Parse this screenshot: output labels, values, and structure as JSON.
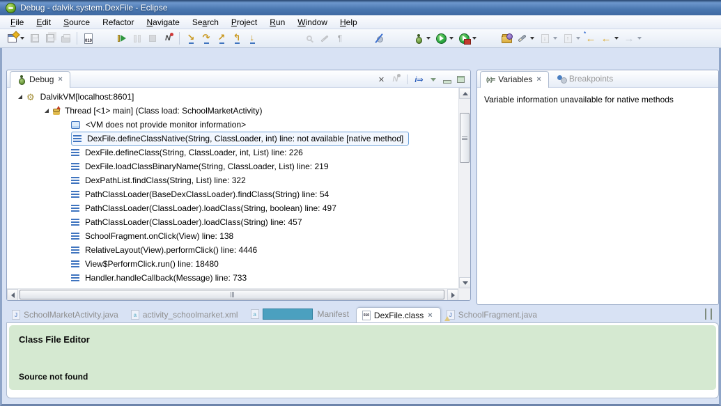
{
  "window": {
    "title": "Debug - dalvik.system.DexFile - Eclipse"
  },
  "menu": {
    "items": [
      {
        "pre": "",
        "key": "F",
        "post": "ile"
      },
      {
        "pre": "",
        "key": "E",
        "post": "dit"
      },
      {
        "pre": "",
        "key": "S",
        "post": "ource"
      },
      {
        "pre": "Refactor",
        "key": "",
        "post": ""
      },
      {
        "pre": "",
        "key": "N",
        "post": "avigate"
      },
      {
        "pre": "Se",
        "key": "a",
        "post": "rch"
      },
      {
        "pre": "",
        "key": "P",
        "post": "roject"
      },
      {
        "pre": "",
        "key": "R",
        "post": "un"
      },
      {
        "pre": "",
        "key": "W",
        "post": "indow"
      },
      {
        "pre": "",
        "key": "H",
        "post": "elp"
      }
    ]
  },
  "glyphs": {
    "gear": "⚙",
    "paragraph": "¶",
    "step_into": "↘",
    "step_over": "↷",
    "step_return": "↗",
    "drop_frame": "↰",
    "step_filters": "↓",
    "back": "←",
    "forward": "→",
    "last_edit": "←",
    "binary": "010",
    "disconnect_n": "N",
    "info": "i⇒",
    "remove_terminated": "✕",
    "close": "×",
    "annot_down": "↓",
    "annot_up": "↑"
  },
  "debug": {
    "tab_label": "Debug",
    "tree": [
      {
        "label": "DalvikVM[localhost:8601]"
      },
      {
        "label": "Thread [<1> main] (Class load: SchoolMarketActivity)"
      },
      {
        "label": "<VM does not provide monitor information>"
      },
      {
        "label": "DexFile.defineClassNative(String, ClassLoader, int) line: not available [native method]"
      },
      {
        "label": "DexFile.defineClass(String, ClassLoader, int, List) line: 226"
      },
      {
        "label": "DexFile.loadClassBinaryName(String, ClassLoader, List) line: 219"
      },
      {
        "label": "DexPathList.findClass(String, List) line: 322"
      },
      {
        "label": "PathClassLoader(BaseDexClassLoader).findClass(String) line: 54"
      },
      {
        "label": "PathClassLoader(ClassLoader).loadClass(String, boolean) line: 497"
      },
      {
        "label": "PathClassLoader(ClassLoader).loadClass(String) line: 457"
      },
      {
        "label": "SchoolFragment.onClick(View) line: 138"
      },
      {
        "label": "RelativeLayout(View).performClick() line: 4446"
      },
      {
        "label": "View$PerformClick.run() line: 18480"
      },
      {
        "label": "Handler.handleCallback(Message) line: 733"
      }
    ]
  },
  "variables": {
    "tab_label": "Variables",
    "variables_icon": "(x)=",
    "breakpoints_tab_label": "Breakpoints",
    "message": "Variable information unavailable for native methods"
  },
  "editor": {
    "tabs": [
      {
        "label": "SchoolMarketActivity.java"
      },
      {
        "label": "activity_schoolmarket.xml"
      },
      {
        "label": "Manifest"
      },
      {
        "label": "DexFile.class"
      },
      {
        "label": "SchoolFragment.java"
      }
    ],
    "heading": "Class File Editor",
    "message": "Source not found"
  },
  "colors": {
    "titlebar_blue": "#4a77b0",
    "desk_background": "#d8e2f4",
    "editor_green": "#d5e9d1",
    "redaction_teal": "#4ba0bf",
    "selection_border": "#6da2da"
  }
}
